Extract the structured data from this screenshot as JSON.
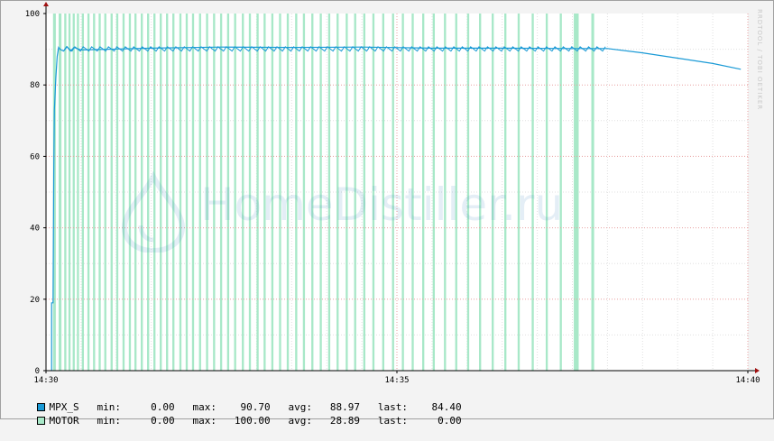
{
  "watermark": "HomeDistiller.ru",
  "side_credit": "RRDTOOL / TOBI OETIKER",
  "colors": {
    "mpx_s": "#1a9ad6",
    "motor": "#a8e8c8",
    "motor_stroke": "#62c896",
    "grid_minor": "#e0e0e0",
    "grid_major": "#e8a0a0",
    "arrow": "#a01010"
  },
  "chart_data": {
    "type": "line",
    "title": "",
    "xlabel": "",
    "ylabel": "",
    "ylim": [
      0,
      100
    ],
    "yticks": [
      0,
      20,
      40,
      60,
      80,
      100
    ],
    "xlim_minutes": [
      14.5,
      24.75
    ],
    "xticks": [
      {
        "label": "14:30",
        "minute": 14.5
      },
      {
        "label": "14:35",
        "minute": 19.5
      },
      {
        "label": "14:40",
        "minute": 24.5
      }
    ],
    "x_note": "minutes past 14:00",
    "series": [
      {
        "name": "MPX_S",
        "kind": "line",
        "points": [
          [
            14.58,
            0
          ],
          [
            14.58,
            19
          ],
          [
            14.6,
            19
          ],
          [
            14.61,
            56
          ],
          [
            14.62,
            73
          ],
          [
            14.64,
            82
          ],
          [
            14.66,
            88
          ],
          [
            14.68,
            90.5
          ],
          [
            14.7,
            90
          ],
          [
            14.75,
            89.5
          ],
          [
            14.8,
            90.7
          ],
          [
            14.85,
            89.5
          ],
          [
            14.9,
            90.5
          ],
          [
            15.0,
            89.8
          ],
          [
            16.0,
            90.3
          ],
          [
            17.0,
            90.6
          ],
          [
            18.0,
            90.5
          ],
          [
            19.0,
            90.6
          ],
          [
            20.0,
            90.3
          ],
          [
            21.0,
            90.3
          ],
          [
            22.0,
            90.2
          ],
          [
            22.5,
            90.2
          ],
          [
            23.0,
            89.0
          ],
          [
            23.5,
            87.5
          ],
          [
            24.0,
            86.0
          ],
          [
            24.4,
            84.4
          ]
        ]
      },
      {
        "name": "MOTOR",
        "kind": "on_off_bars",
        "on_intervals": [
          [
            14.6,
            14.64
          ],
          [
            14.68,
            14.72
          ],
          [
            14.76,
            14.79
          ],
          [
            14.82,
            14.85
          ],
          [
            14.88,
            14.91
          ],
          [
            14.94,
            14.97
          ],
          [
            15.01,
            15.04
          ],
          [
            15.09,
            15.12
          ],
          [
            15.17,
            15.2
          ],
          [
            15.25,
            15.28
          ],
          [
            15.33,
            15.36
          ],
          [
            15.42,
            15.45
          ],
          [
            15.5,
            15.53
          ],
          [
            15.59,
            15.62
          ],
          [
            15.68,
            15.71
          ],
          [
            15.76,
            15.79
          ],
          [
            15.85,
            15.88
          ],
          [
            15.94,
            15.97
          ],
          [
            16.03,
            16.06
          ],
          [
            16.12,
            16.15
          ],
          [
            16.21,
            16.24
          ],
          [
            16.3,
            16.33
          ],
          [
            16.4,
            16.43
          ],
          [
            16.49,
            16.52
          ],
          [
            16.58,
            16.61
          ],
          [
            16.68,
            16.71
          ],
          [
            16.78,
            16.81
          ],
          [
            16.88,
            16.91
          ],
          [
            16.98,
            17.01
          ],
          [
            17.08,
            17.11
          ],
          [
            17.18,
            17.21
          ],
          [
            17.29,
            17.32
          ],
          [
            17.39,
            17.42
          ],
          [
            17.5,
            17.53
          ],
          [
            17.6,
            17.63
          ],
          [
            17.71,
            17.74
          ],
          [
            17.82,
            17.85
          ],
          [
            17.93,
            17.96
          ],
          [
            18.05,
            18.08
          ],
          [
            18.16,
            18.19
          ],
          [
            18.28,
            18.31
          ],
          [
            18.4,
            18.43
          ],
          [
            18.52,
            18.55
          ],
          [
            18.64,
            18.67
          ],
          [
            18.77,
            18.8
          ],
          [
            18.89,
            18.92
          ],
          [
            19.02,
            19.05
          ],
          [
            19.15,
            19.18
          ],
          [
            19.29,
            19.32
          ],
          [
            19.43,
            19.46
          ],
          [
            19.57,
            19.6
          ],
          [
            19.71,
            19.74
          ],
          [
            19.86,
            19.89
          ],
          [
            20.01,
            20.04
          ],
          [
            20.17,
            20.2
          ],
          [
            20.33,
            20.36
          ],
          [
            20.5,
            20.53
          ],
          [
            20.67,
            20.7
          ],
          [
            20.85,
            20.88
          ],
          [
            21.03,
            21.06
          ],
          [
            21.22,
            21.25
          ],
          [
            21.42,
            21.45
          ],
          [
            21.62,
            21.65
          ],
          [
            21.82,
            21.85
          ],
          [
            22.02,
            22.09
          ],
          [
            22.27,
            22.31
          ]
        ]
      }
    ],
    "legend": [
      {
        "name": "MPX_S",
        "min": "0.00",
        "max": "90.70",
        "avg": "88.97",
        "last": "84.40"
      },
      {
        "name": "MOTOR",
        "min": "0.00",
        "max": "100.00",
        "avg": "28.89",
        "last": "0.00"
      }
    ],
    "legend_labels": {
      "min": "min:",
      "max": "max:",
      "avg": "avg:",
      "last": "last:"
    }
  }
}
